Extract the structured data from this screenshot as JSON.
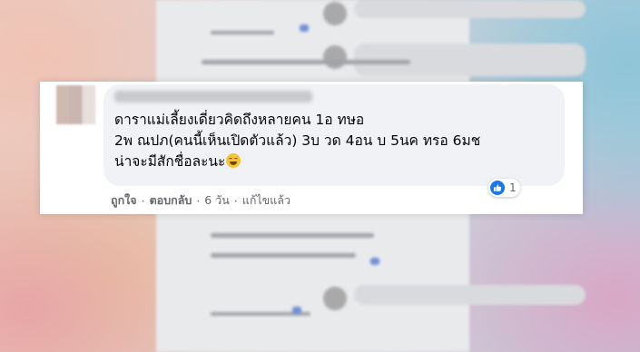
{
  "comment": {
    "text_lines": [
      "ดาราแม่เลี้ยงเดี่ยวคิดถึงหลายคน 1อ ทษอ",
      "2พ ณปภ(คนนี้เห็นเปิดตัวแล้ว) 3บ วด 4อน บ 5นค ทรอ 6มช",
      "น่าจะมีสักชื่อละนะ"
    ],
    "emoji": "grinning-smile",
    "reaction_count": "1"
  },
  "actions": {
    "like": "ถูกใจ",
    "reply": "ตอบกลับ",
    "time": "6 วัน",
    "edited": "แก้ไขแล้ว",
    "separator": "·"
  },
  "colors": {
    "like_blue": "#1877f2",
    "bubble": "#f0f2f5",
    "meta_text": "#65676b"
  }
}
